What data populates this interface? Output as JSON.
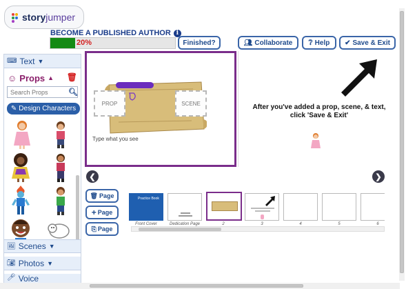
{
  "header": {
    "logo_text_a": "story",
    "logo_text_b": "jumper",
    "become_label": "BECOME A PUBLISHED AUTHOR",
    "progress_percent": 20,
    "progress_label": "20%",
    "finished_label": "Finished?",
    "collaborate_label": "Collaborate",
    "help_label": "Help",
    "save_exit_label": "Save & Exit"
  },
  "sidebar": {
    "text_label": "Text",
    "props_label": "Props",
    "search_placeholder": "Search Props",
    "design_label": "Design Characters",
    "scenes_label": "Scenes",
    "photos_label": "Photos",
    "voice_label": "Voice"
  },
  "editor": {
    "prop_box": "PROP",
    "scene_box": "SCENE",
    "type_placeholder": "Type what you see",
    "hint_line1": "After you've added a prop, scene, & text,",
    "hint_line2": "click 'Save & Exit'"
  },
  "pages": {
    "page_label": "Page",
    "thumbnails": [
      {
        "label": "Front Cover",
        "cover_text": "Practice Book"
      },
      {
        "label": "Dedication Page"
      },
      {
        "label": "2"
      },
      {
        "label": "3"
      },
      {
        "label": "4"
      },
      {
        "label": "5"
      },
      {
        "label": "6"
      }
    ]
  },
  "colors": {
    "accent": "#7a2d8a",
    "primary": "#2b5fa8",
    "progress": "#148a14"
  }
}
